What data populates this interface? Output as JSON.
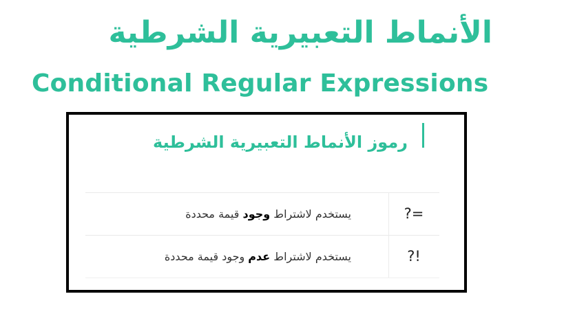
{
  "title_ar": "الأنماط التعبيرية الشرطية",
  "title_en": "Conditional Regular Expressions",
  "card": {
    "title": "رموز الأنماط التعبيرية الشرطية",
    "rows": [
      {
        "symbol": "?=",
        "desc_before": "يستخدم لاشتراط",
        "desc_bold": "وجود",
        "desc_after": "قيمة محددة"
      },
      {
        "symbol": "?!",
        "desc_before": "يستخدم لاشتراط",
        "desc_bold": "عدم",
        "desc_after": "وجود قيمة محددة"
      }
    ]
  },
  "colors": {
    "accent": "#2ebf9a",
    "border": "#000000"
  }
}
